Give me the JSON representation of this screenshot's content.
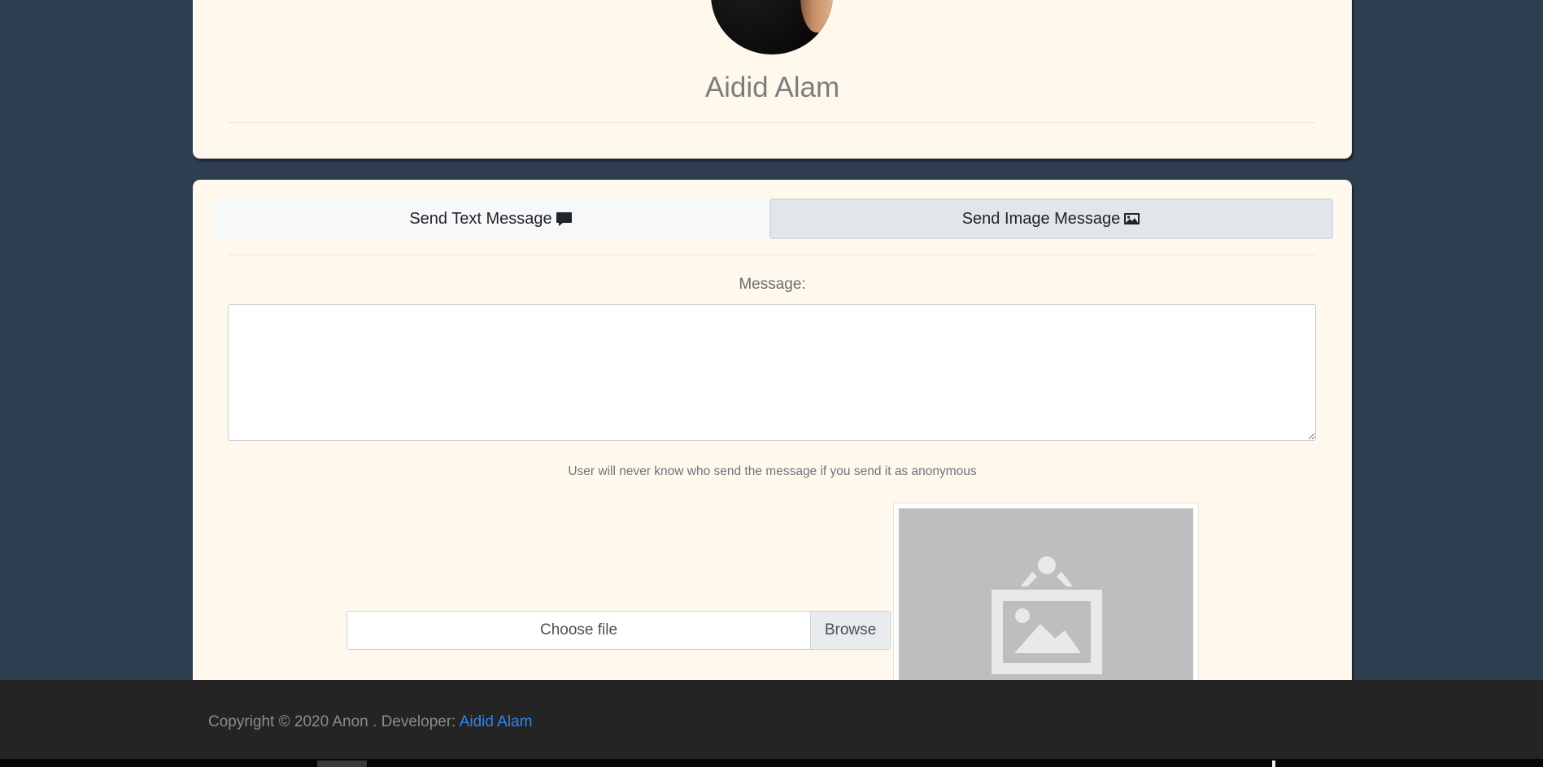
{
  "profile": {
    "name": "Aidid Alam"
  },
  "tabs": [
    {
      "label": "Send Text Message",
      "icon": "comment-icon"
    },
    {
      "label": "Send Image Message",
      "icon": "image-icon"
    }
  ],
  "form": {
    "message_label": "Message:",
    "message_value": "",
    "hint": "User will never know who send the message if you send it as anonymous",
    "file_label": "Choose file",
    "browse_label": "Browse",
    "preview_icon": "image-placeholder-icon"
  },
  "footer": {
    "copyright": "Copyright © 2020 Anon . Developer: ",
    "developer_link": "Aidid Alam"
  },
  "colors": {
    "background": "#2e3e50",
    "card": "#fef9ec",
    "footer": "#242424",
    "link": "#2a86f3"
  }
}
